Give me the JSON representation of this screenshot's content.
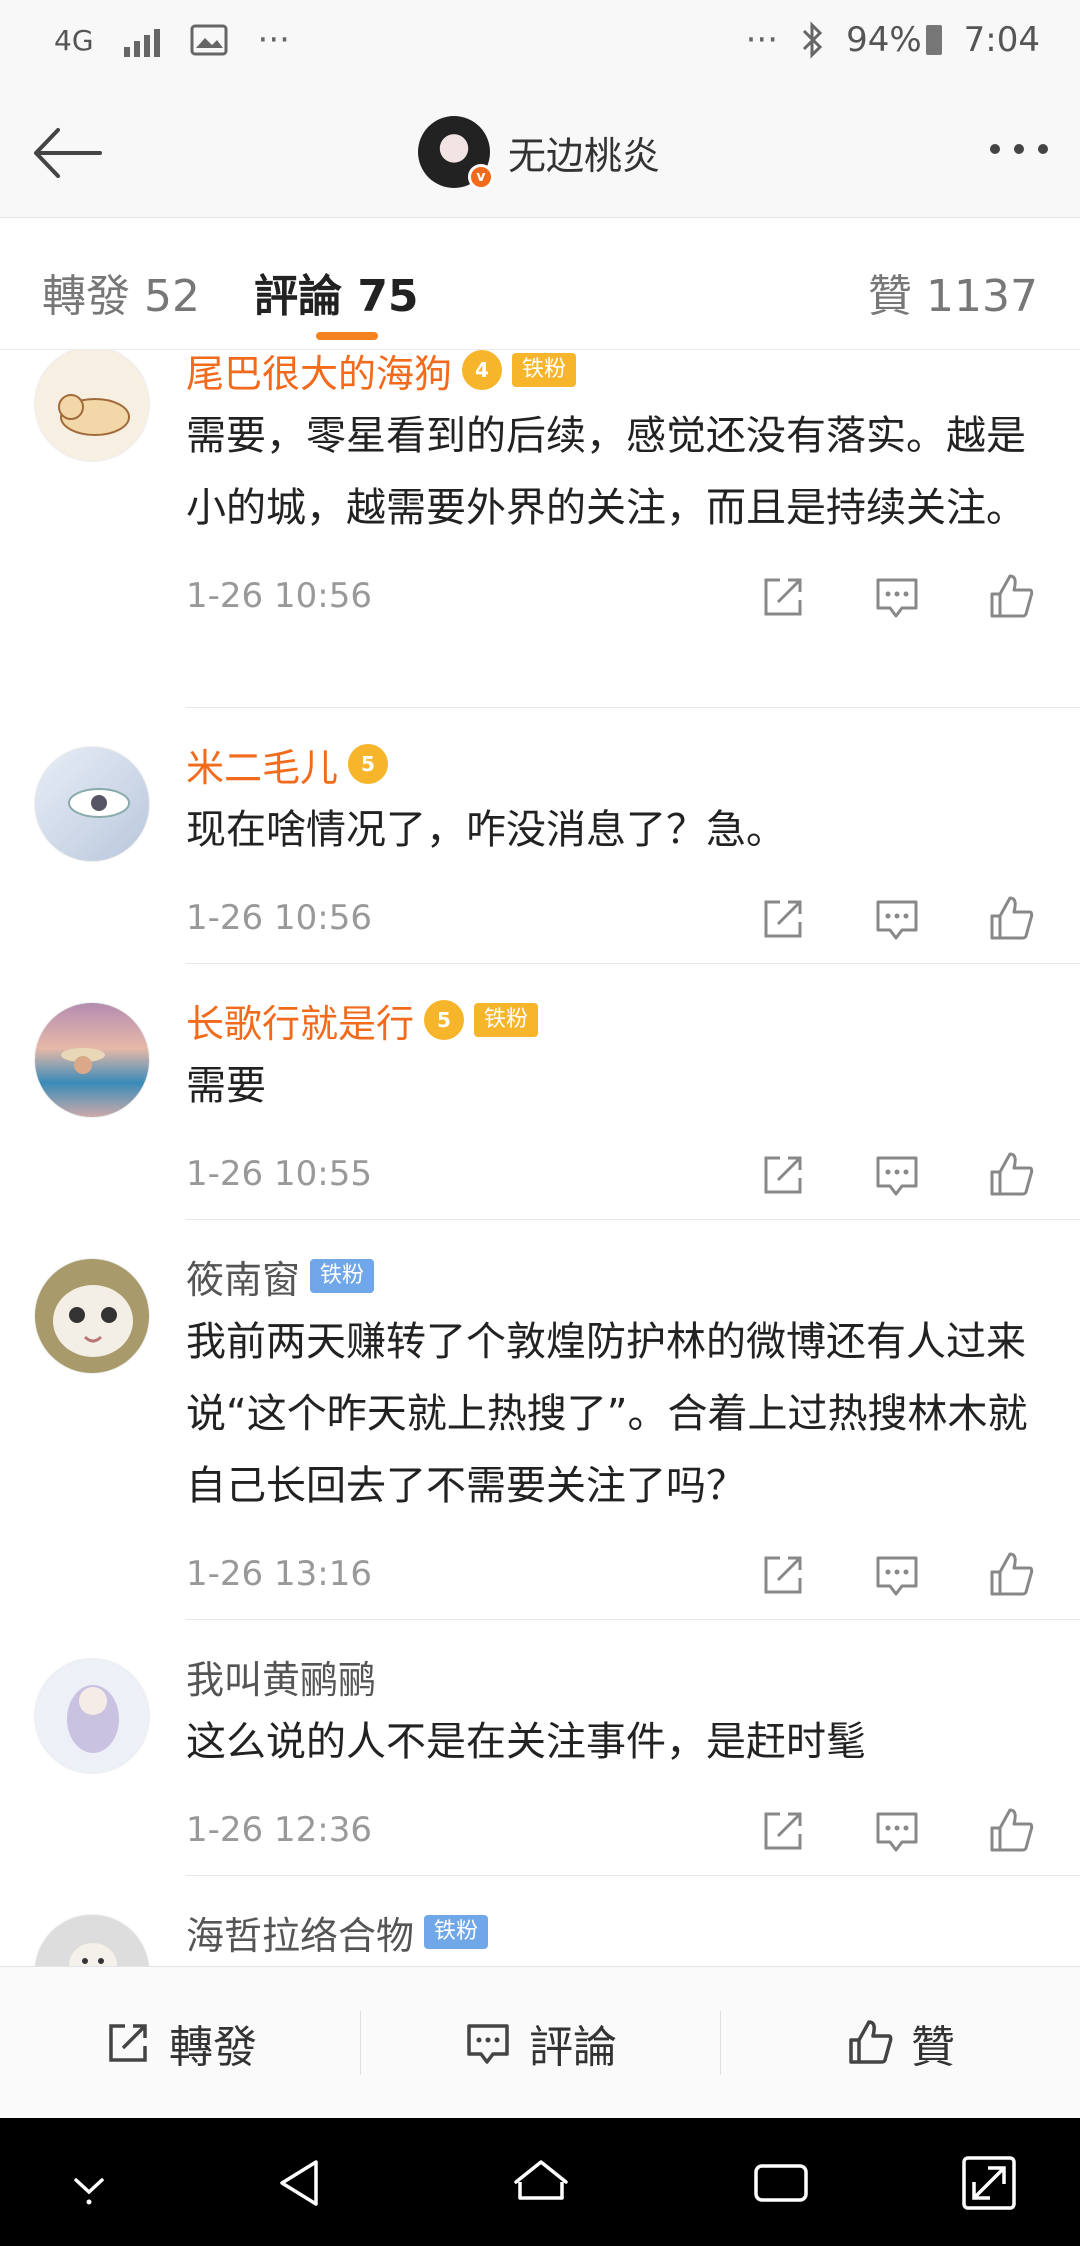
{
  "status_bar": {
    "network": "4G",
    "battery": "94%",
    "time": "7:04"
  },
  "header": {
    "username": "无边桃炎"
  },
  "tabs": {
    "repost": "轉發 52",
    "comment": "評論 75",
    "like": "贊 1137"
  },
  "comments": [
    {
      "name": "尾巴很大的海狗",
      "name_style": "orange",
      "level": "4",
      "fan_badge": "铁粉",
      "text": "需要，零星看到的后续，感觉还没有落实。越是小的城，越需要外界的关注，而且是持续关注。",
      "time": "1-26 10:56"
    },
    {
      "name": "米二毛儿",
      "name_style": "orange",
      "level": "5",
      "fan_badge": "",
      "text": "现在啥情况了，咋没消息了？急。",
      "time": "1-26 10:56"
    },
    {
      "name": "长歌行就是行",
      "name_style": "orange",
      "level": "5",
      "fan_badge": "铁粉",
      "text": "需要",
      "time": "1-26 10:55"
    },
    {
      "name": "筱南窗",
      "name_style": "grey",
      "level": "",
      "fan_badge": "铁粉",
      "text": "我前两天赚转了个敦煌防护林的微博还有人过来说“这个昨天就上热搜了”。合着上过热搜林木就自己长回去了不需要关注了吗？",
      "time": "1-26 13:16"
    },
    {
      "name": "我叫黄鹂鹂",
      "name_style": "grey",
      "level": "",
      "fan_badge": "",
      "text": "这么说的人不是在关注事件，是赶时髦",
      "time": "1-26 12:36"
    },
    {
      "name": "海哲拉络合物",
      "name_style": "grey",
      "level": "",
      "fan_badge": "铁粉",
      "text": "",
      "time": ""
    }
  ],
  "bottom_bar": {
    "repost": "轉發",
    "comment": "評論",
    "like": "贊"
  },
  "colors": {
    "accent": "#f26a1b",
    "tab_underline": "#f58220",
    "fan_badge_gold": "#f7b52c",
    "fan_badge_blue": "#6fa7e8"
  }
}
